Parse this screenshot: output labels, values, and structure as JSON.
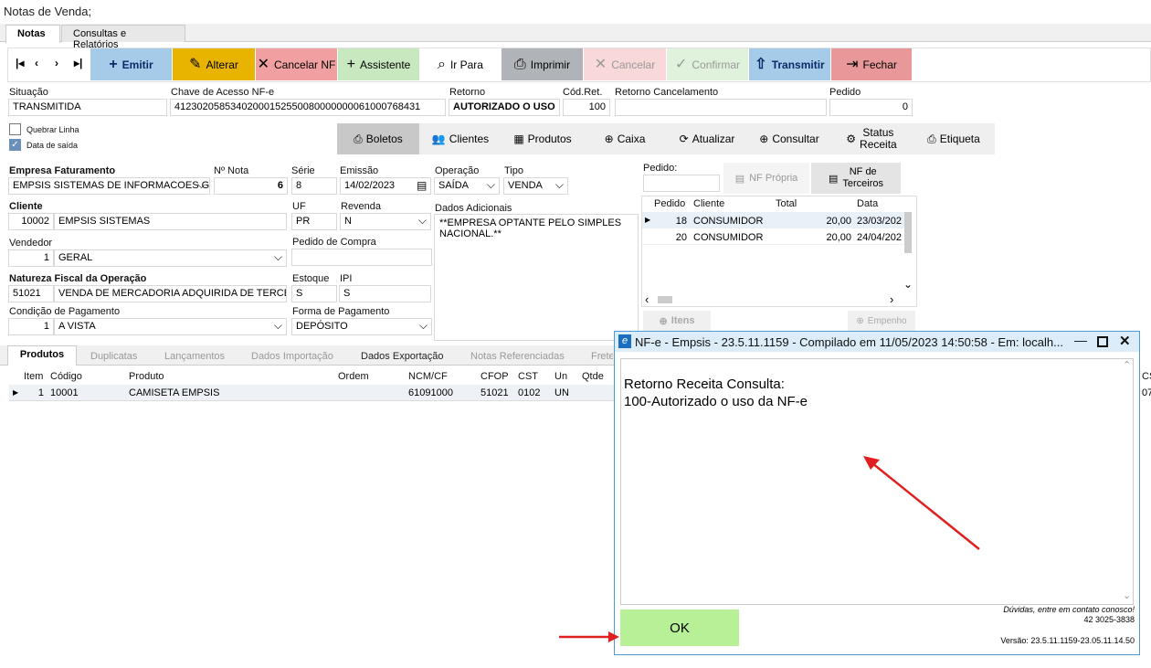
{
  "window": {
    "title": "Notas de Venda;"
  },
  "tabs": [
    {
      "label": "Notas"
    },
    {
      "label": "Consultas e Relatórios"
    }
  ],
  "toolbar": {
    "emitir": "Emitir",
    "alterar": "Alterar",
    "cancelar_nf": "Cancelar NF",
    "assistente": "Assistente",
    "ir_para": "Ir Para",
    "imprimir": "Imprimir",
    "cancelar": "Cancelar",
    "confirmar": "Confirmar",
    "transmitir": "Transmitir",
    "fechar": "Fechar"
  },
  "header": {
    "situacao_label": "Situação",
    "situacao": "TRANSMITIDA",
    "chave_label": "Chave de Acesso NF-e",
    "chave": "41230205853402000152550080000000061000768431",
    "retorno_label": "Retorno",
    "retorno": "AUTORIZADO O USO",
    "codret_label": "Cód.Ret.",
    "codret": "100",
    "retcanc_label": "Retorno Cancelamento",
    "retcanc": "",
    "pedido_label": "Pedido",
    "pedido": "0"
  },
  "options": {
    "quebrar_linha": "Quebrar Linha",
    "data_saida": "Data de saída"
  },
  "secondary": {
    "boletos": "Boletos",
    "clientes": "Clientes",
    "produtos": "Produtos",
    "caixa": "Caixa",
    "atualizar": "Atualizar",
    "consultar": "Consultar",
    "status_receita_1": "Status",
    "status_receita_2": "Receita",
    "etiqueta": "Etiqueta"
  },
  "form": {
    "empresa_label": "Empresa Faturamento",
    "empresa": "EMPSIS SISTEMAS DE INFORMACOES GEI",
    "nnota_label": "Nº Nota",
    "nnota": "6",
    "serie_label": "Série",
    "serie": "8",
    "emissao_label": "Emissão",
    "emissao": "14/02/2023",
    "operacao_label": "Operação",
    "operacao": "SAÍDA",
    "tipo_label": "Tipo",
    "tipo": "VENDA",
    "cliente_label": "Cliente",
    "cliente_cod": "10002",
    "cliente": "EMPSIS SISTEMAS",
    "uf_label": "UF",
    "uf": "PR",
    "revenda_label": "Revenda",
    "revenda": "N",
    "dados_label": "Dados Adicionais",
    "dados": "**EMPRESA OPTANTE PELO SIMPLES NACIONAL.**",
    "vendedor_label": "Vendedor",
    "vendedor_cod": "1",
    "vendedor": "GERAL",
    "pedcompra_label": "Pedido de Compra",
    "natureza_label": "Natureza Fiscal da Operação",
    "natureza_cod": "51021",
    "natureza": "VENDA DE MERCADORIA ADQUIRIDA DE TERCEIR",
    "estoque_label": "Estoque",
    "estoque": "S",
    "ipi_label": "IPI",
    "ipi": "S",
    "condpag_label": "Condição de Pagamento",
    "condpag_cod": "1",
    "condpag": "A VISTA",
    "formapag_label": "Forma de Pagamento",
    "formapag": "DEPÓSITO"
  },
  "pedidos": {
    "label": "Pedido:",
    "nf_propria": "NF Própria",
    "nf_terceiros_1": "NF de",
    "nf_terceiros_2": "Terceiros",
    "cols": [
      "Pedido",
      "Cliente",
      "Total",
      "Data"
    ],
    "rows": [
      {
        "pedido": "18",
        "cliente": "CONSUMIDOR",
        "total": "20,00",
        "data": "23/03/202"
      },
      {
        "pedido": "20",
        "cliente": "CONSUMIDOR",
        "total": "20,00",
        "data": "24/04/202"
      }
    ],
    "itens": "Itens",
    "empenho": "Empenho"
  },
  "bottom_tabs": [
    {
      "label": "Produtos"
    },
    {
      "label": "Duplicatas"
    },
    {
      "label": "Lançamentos"
    },
    {
      "label": "Dados Importação"
    },
    {
      "label": "Dados Exportação"
    },
    {
      "label": "Notas Referenciadas"
    },
    {
      "label": "Frete"
    }
  ],
  "items": {
    "cols": [
      "Item",
      "Código",
      "Produto",
      "Ordem",
      "NCM/CF",
      "CFOP",
      "CST",
      "Un",
      "Qtde"
    ],
    "rows": [
      {
        "item": "1",
        "codigo": "10001",
        "produto": "CAMISETA EMPSIS",
        "ordem": "",
        "ncm": "61091000",
        "cfop": "51021",
        "cst": "0102",
        "un": "UN"
      }
    ],
    "cs_col": "CS",
    "cs_val": "07"
  },
  "dialog": {
    "title": "NF-e - Empsis - 23.5.11.1159 - Compilado em 11/05/2023 14:50:58 - Em: localh...",
    "line1": "Retorno Receita Consulta:",
    "line2": "100-Autorizado o uso da NF-e",
    "duvidas": "Dúvidas, entre em contato conosco!",
    "phone": "42 3025-3838",
    "ok": "OK",
    "versao": "Versão: 23.5.11.1159-23.05.11.14.50"
  },
  "colors": {
    "emitir": "#a6cbe8",
    "alterar": "#e8b400",
    "cancelar_nf": "#f0a0a0",
    "assistente": "#c8e8c0",
    "imprimir": "#b0b4b8",
    "transmitir": "#a6cbe8",
    "fechar": "#e89898",
    "ok": "#b8f098",
    "arrow": "#e02020"
  }
}
